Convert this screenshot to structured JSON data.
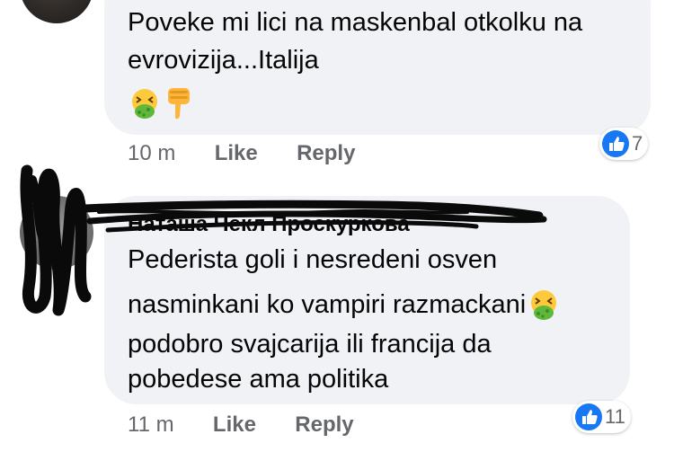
{
  "comments": [
    {
      "lines": [
        "Poveke mi lici na maskenbal otkolku na",
        "evrovizija...Italija"
      ],
      "reactions_inline": [
        "nauseated-face-emoji",
        "thumbs-down-emoji"
      ],
      "time": "10 m",
      "like_label": "Like",
      "reply_label": "Reply",
      "reaction_count": "7"
    },
    {
      "author": "Наташа Чекл Проскуркова",
      "lines": [
        "Pederista goli i nesredeni osven",
        "nasminkani ko vampiri razmackani",
        "podobro svajcarija ili francija da",
        "pobedese ama politika"
      ],
      "time": "11 m",
      "like_label": "Like",
      "reply_label": "Reply",
      "reaction_count": "11"
    }
  ],
  "colors": {
    "bubble": "#f0f2f5",
    "meta_text": "#65676b",
    "like_blue": "#1877f2",
    "emoji_yellow": "#ffc93c",
    "emoji_green": "#5fb83b"
  }
}
